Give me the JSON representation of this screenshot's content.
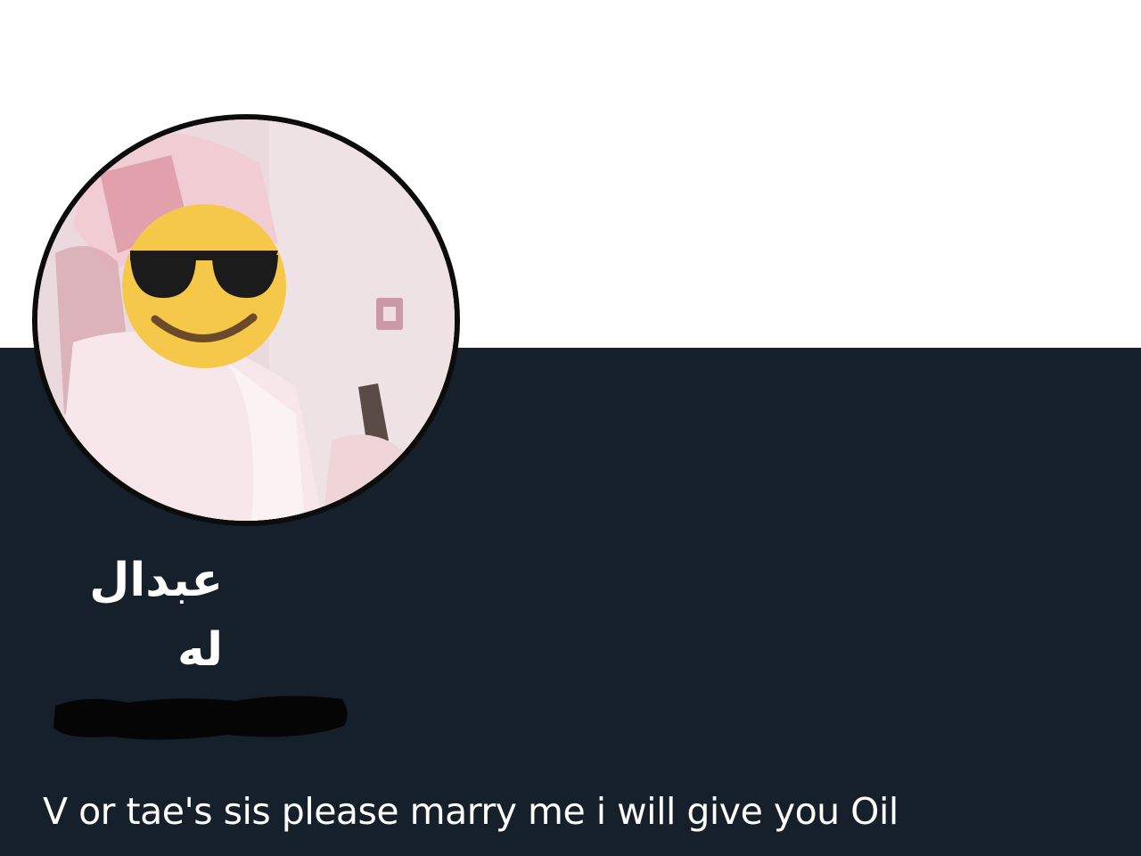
{
  "profile": {
    "display_name_line1": "عبدال",
    "display_name_line2": "له",
    "bio": "V or tae's sis please marry me i will give you Oil",
    "avatar_overlay_icon": "smiling-face-with-sunglasses-icon",
    "handle_redacted": true
  },
  "colors": {
    "banner": "#ffffff",
    "background": "#15202b",
    "text": "#ffffff",
    "emoji_face": "#f6c84a"
  }
}
